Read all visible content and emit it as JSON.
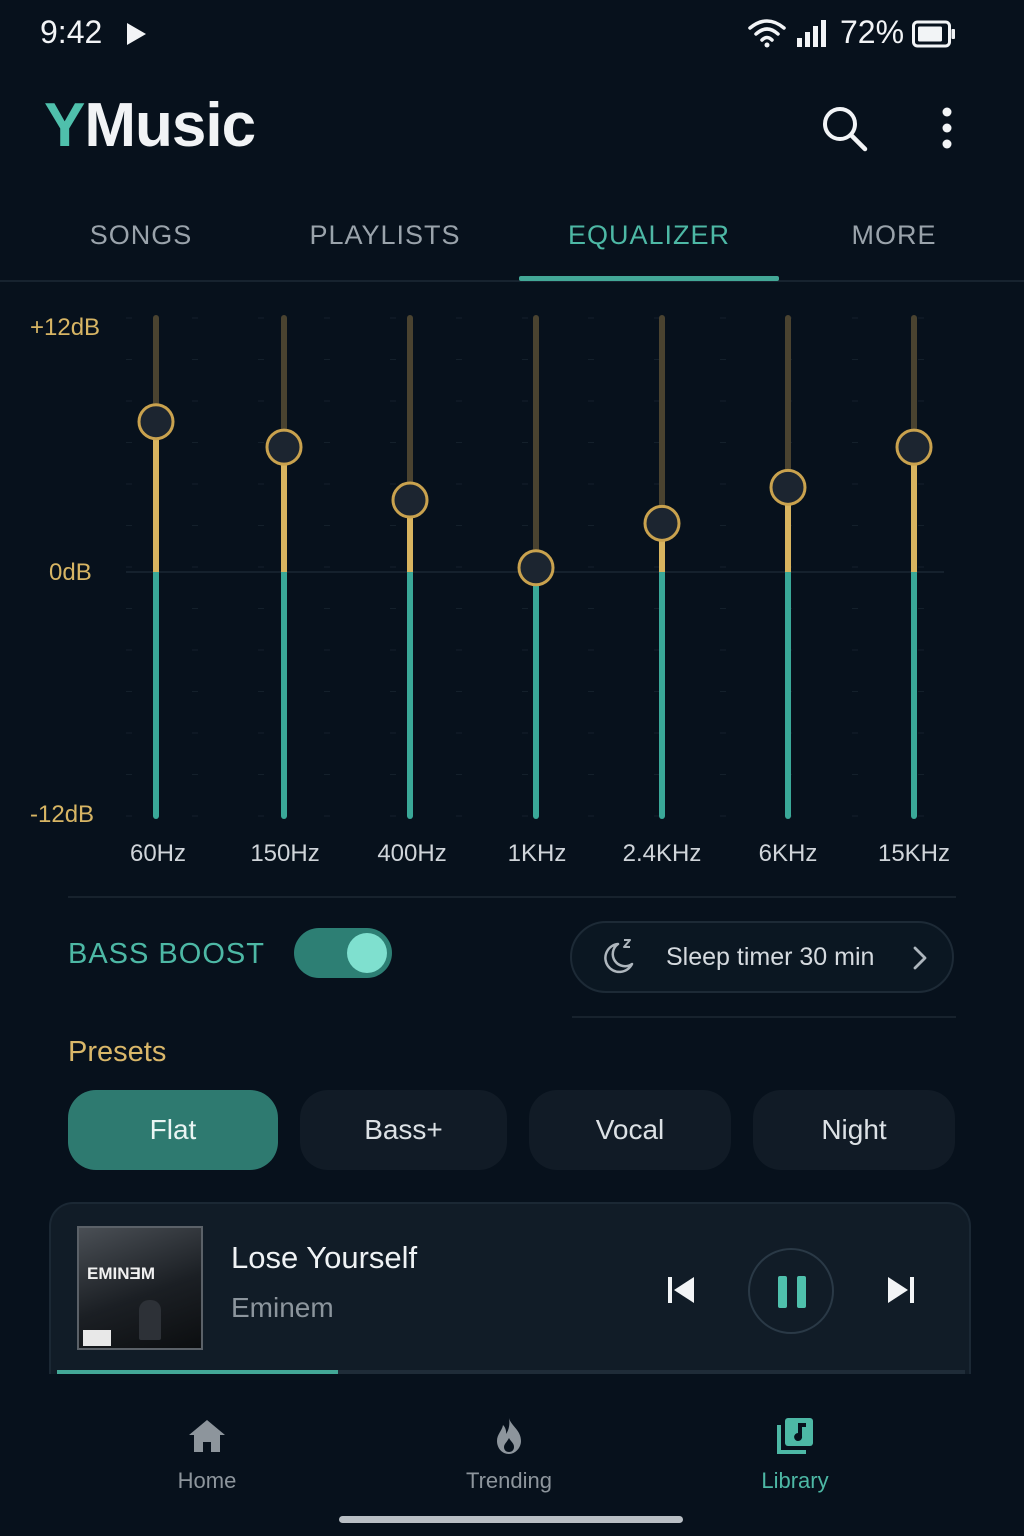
{
  "status": {
    "time": "9:42",
    "battery": "72%"
  },
  "app": {
    "logo_first": "Y",
    "logo_rest": "Music"
  },
  "tabs": [
    {
      "label": "SONGS",
      "active": false
    },
    {
      "label": "PLAYLISTS",
      "active": false
    },
    {
      "label": "EQUALIZER",
      "active": true
    },
    {
      "label": "MORE",
      "active": false
    }
  ],
  "equalizer": {
    "max_label": "+12dB",
    "zero_label": "0dB",
    "min_label": "-12dB",
    "range_db": [
      -12,
      12
    ],
    "bands": [
      {
        "label": "60Hz",
        "value_db": 7.1
      },
      {
        "label": "150Hz",
        "value_db": 5.9
      },
      {
        "label": "400Hz",
        "value_db": 3.4
      },
      {
        "label": "1KHz",
        "value_db": 0.2
      },
      {
        "label": "2.4KHz",
        "value_db": 2.3
      },
      {
        "label": "6KHz",
        "value_db": 4.0
      },
      {
        "label": "15KHz",
        "value_db": 5.9
      }
    ],
    "colors": {
      "boost": "#d8b45f",
      "cut": "#3aa898",
      "knob_ring": "#c9a24e",
      "knob_fill": "#1c2530"
    }
  },
  "bass_boost": {
    "label": "BASS BOOST",
    "enabled": true
  },
  "sleep_timer": {
    "label": "Sleep timer 30 min"
  },
  "presets": {
    "title": "Presets",
    "items": [
      {
        "label": "Flat",
        "active": true
      },
      {
        "label": "Bass+",
        "active": false
      },
      {
        "label": "Vocal",
        "active": false
      },
      {
        "label": "Night",
        "active": false
      }
    ]
  },
  "now_playing": {
    "title": "Lose Yourself",
    "artist": "Eminem",
    "album_art_text": "EMINƎM",
    "progress": 0.31
  },
  "bottom_nav": [
    {
      "label": "Home",
      "icon": "home-icon",
      "active": false
    },
    {
      "label": "Trending",
      "icon": "flame-icon",
      "active": false
    },
    {
      "label": "Library",
      "icon": "library-icon",
      "active": true
    }
  ]
}
